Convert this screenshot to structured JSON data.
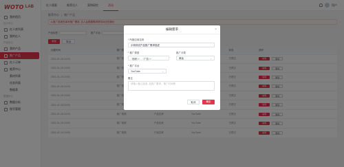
{
  "logo": {
    "brand": "WOTO",
    "lab": "LAB"
  },
  "sidebar": {
    "items": [
      {
        "label": "我的首页",
        "type": "item"
      },
      {
        "label": "达人中心",
        "type": "section"
      },
      {
        "label": "红人库列表",
        "type": "item"
      },
      {
        "label": "我的红人",
        "type": "item"
      },
      {
        "label": "产品中心",
        "type": "section"
      },
      {
        "label": "我的产品",
        "type": "item"
      },
      {
        "label": "推广产品",
        "type": "item",
        "active": true
      },
      {
        "label": "红人订单",
        "type": "item"
      },
      {
        "label": "推荐中心",
        "type": "item"
      },
      {
        "label": "素材列表",
        "type": "sub"
      },
      {
        "label": "任务列表",
        "type": "sub"
      },
      {
        "label": "数据表",
        "type": "sub"
      },
      {
        "label": "数据中心",
        "type": "section"
      },
      {
        "label": "数据分析",
        "type": "item"
      },
      {
        "label": "账号管理",
        "type": "item"
      }
    ]
  },
  "topbar": {
    "tabs": [
      {
        "label": "红人搜索",
        "active": false
      },
      {
        "label": "推荐达人",
        "active": false
      },
      {
        "label": "案例研究",
        "active": false
      },
      {
        "label": "活动",
        "active": true
      }
    ],
    "user": "用户"
  },
  "main": {
    "breadcrumb": [
      "推荐中心",
      "推广产品"
    ],
    "notice": "● 推广前请先填写推广需求, 达人会根据需求提供对应的报价",
    "filters": [
      {
        "label": "产品标签"
      },
      {
        "label": "推广平台"
      },
      {
        "label": "推广类型"
      },
      {
        "label": "产品标签"
      }
    ],
    "actions": {
      "add": "添加",
      "export": "导出"
    },
    "table": {
      "headers": [
        "创建时间",
        "推广类型",
        "产品信息",
        "推广平台",
        "状态",
        "操作"
      ],
      "rows": [
        {
          "date": "2021-01-15 10:00",
          "type": "推广视频",
          "info": "产品名称",
          "platform": "YouTube",
          "status": "已提交"
        },
        {
          "date": "2021-01-15 10:00",
          "type": "推广视频",
          "info": "产品名称",
          "platform": "YouTube",
          "status": "已提交"
        },
        {
          "date": "2021-01-15 10:00",
          "type": "推广视频",
          "info": "产品名称",
          "platform": "YouTube",
          "status": "已提交"
        },
        {
          "date": "2021-01-15 10:00",
          "type": "推广视频",
          "info": "产品名称",
          "platform": "YouTube",
          "status": "已提交"
        },
        {
          "date": "2021-01-15 10:00",
          "type": "推广视频",
          "info": "产品名称",
          "platform": "YouTube",
          "status": "已提交"
        },
        {
          "date": "2021-01-15 10:00",
          "type": "推广视频",
          "info": "产品名称",
          "platform": "YouTube",
          "status": "已提交"
        },
        {
          "date": "2021-01-15 10:00",
          "type": "推广视频",
          "info": "产品名称",
          "platform": "YouTube",
          "status": "已提交"
        },
        {
          "date": "2021-01-15 10:00",
          "type": "推广视频",
          "info": "产品名称",
          "platform": "YouTube",
          "status": "已提交"
        },
        {
          "date": "2021-01-15 10:00",
          "type": "推广视频",
          "info": "产品名称",
          "platform": "YouTube",
          "status": "已提交"
        }
      ],
      "op_edit": "编辑",
      "op_delete": "删除"
    }
  },
  "modal": {
    "title": "编辑需求",
    "field_product_label": "* 所推应用名称",
    "field_product_value": "示例测试产品推广需求描述",
    "field_category_label": "* 推广类型",
    "field_category_tags": [
      "视频",
      "广告"
    ],
    "field_subcat_label": "推广分类",
    "field_subcat_value": "美妆",
    "field_platform_label": "* 推广平台",
    "field_platform_value": "YouTube",
    "field_note_label": "备注",
    "field_note_placeholder": "请输入备注信息, 如推广要求、推广时间等",
    "cancel": "取消",
    "confirm": "确定"
  },
  "colors": {
    "accent": "#e8344e"
  }
}
